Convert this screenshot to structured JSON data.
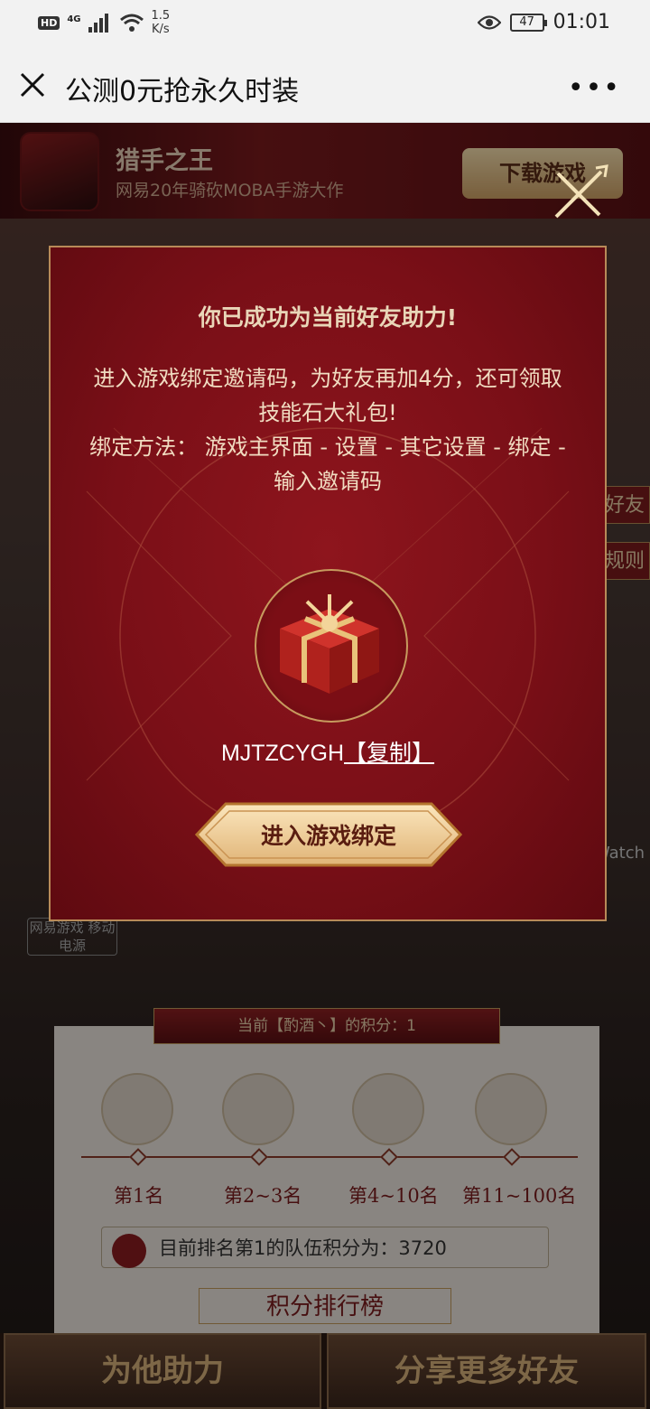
{
  "status_bar": {
    "hd": "HD",
    "network": "4G",
    "speed_value": "1.5",
    "speed_unit": "K/s",
    "battery": "47",
    "time": "01:01"
  },
  "titlebar": {
    "title": "公测0元抢永久时装",
    "more": "•••"
  },
  "app_banner": {
    "name": "猎手之王",
    "desc": "网易20年骑砍MOBA手游大作",
    "download": "下载游戏"
  },
  "side_tags": {
    "friends": "好友",
    "rules": "规则",
    "watch": "Watch",
    "power_bank": "网易游戏 移动电源"
  },
  "rank_panel": {
    "header": "当前【酌酒丶】的积分：1",
    "labels": [
      "第1名",
      "第2~3名",
      "第4~10名",
      "第11~100名"
    ],
    "notice": "目前排名第1的队伍积分为：3720",
    "board_title": "积分排行榜"
  },
  "bottom": {
    "help": "为他助力",
    "share": "分享更多好友"
  },
  "modal": {
    "title": "你已成功为当前好友助力!",
    "body_line1": "进入游戏绑定邀请码，为好友再加4分，还可领取技能石大礼包!",
    "body_line2": "绑定方法： 游戏主界面 - 设置 - 其它设置 - 绑定 - 输入邀请码",
    "code": "MJTZCYGH",
    "copy": "【复制】",
    "enter": "进入游戏绑定"
  }
}
